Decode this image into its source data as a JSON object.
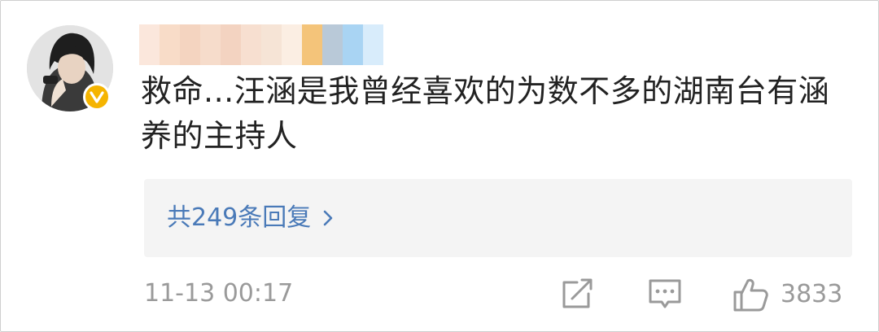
{
  "comment": {
    "username_pixel_colors": [
      "#fbe7dc",
      "#f8dcc8",
      "#f4d4c0",
      "#f6dccb",
      "#f3d3c1",
      "#f7dfd0",
      "#f6e4d6",
      "#fbeee3",
      "#f4c47a",
      "#b9c9d8",
      "#a9d4f3",
      "#d8ecfb"
    ],
    "text": "救命...汪涵是我曾经喜欢的为数不多的湖南台有涵养的主持人",
    "replies_label": "共249条回复",
    "timestamp": "11-13 00:17",
    "like_count": "3833"
  },
  "icons": {
    "avatar": "user-avatar",
    "badge": "verified-v-badge",
    "replies": "chevron-right-icon",
    "share": "share-icon",
    "comment": "comment-icon",
    "like": "thumbs-up-icon"
  },
  "colors": {
    "link": "#4a7ab8",
    "meta": "#9a9a9a",
    "badge": "#f5b400",
    "reply_bg": "#f4f4f4"
  }
}
